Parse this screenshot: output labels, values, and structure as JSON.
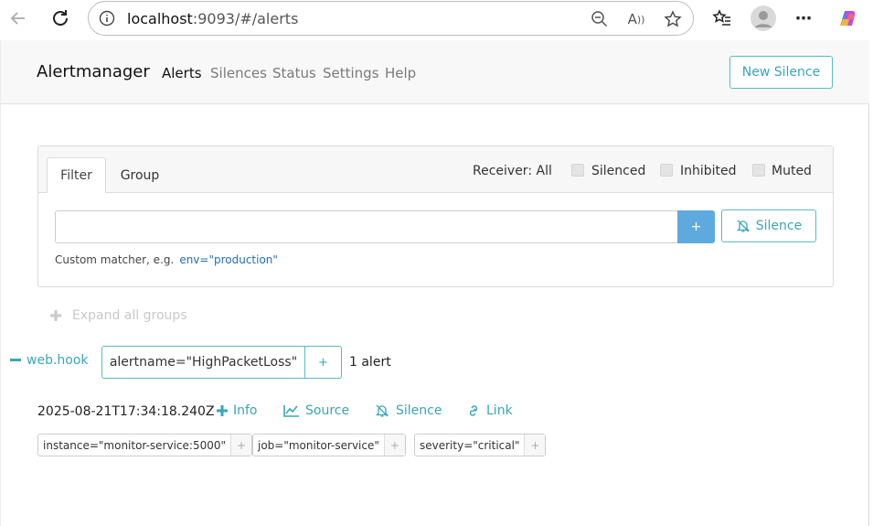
{
  "browser": {
    "url_host": "localhost",
    "url_path": ":9093/#/alerts"
  },
  "navbar": {
    "brand": "Alertmanager",
    "links": [
      "Alerts",
      "Silences",
      "Status",
      "Settings",
      "Help"
    ],
    "new_silence_label": "New Silence"
  },
  "filter_card": {
    "tabs": [
      "Filter",
      "Group"
    ],
    "receiver_label": "Receiver: All",
    "checkboxes": [
      "Silenced",
      "Inhibited",
      "Muted"
    ],
    "matcher_value": "",
    "add_button_label": "+",
    "silence_button_label": "Silence",
    "hint_text": "Custom matcher, e.g.",
    "hint_example": "env=\"production\""
  },
  "expand_all_label": "Expand all groups",
  "group": {
    "receiver": "web.hook",
    "label": "alertname=\"HighPacketLoss\"",
    "add_label": "+",
    "count": "1 alert"
  },
  "alert": {
    "timestamp": "2025-08-21T17:34:18.240Z",
    "actions": [
      "Info",
      "Source",
      "Silence",
      "Link"
    ],
    "labels": [
      {
        "text": "instance=\"monitor-service:5000\"",
        "add": "+"
      },
      {
        "text": "job=\"monitor-service\"",
        "add": "+"
      },
      {
        "text": "severity=\"critical\"",
        "add": "+"
      }
    ]
  },
  "colors": {
    "accent": "#3aa5b8",
    "primary_button": "#5ea9dd"
  }
}
